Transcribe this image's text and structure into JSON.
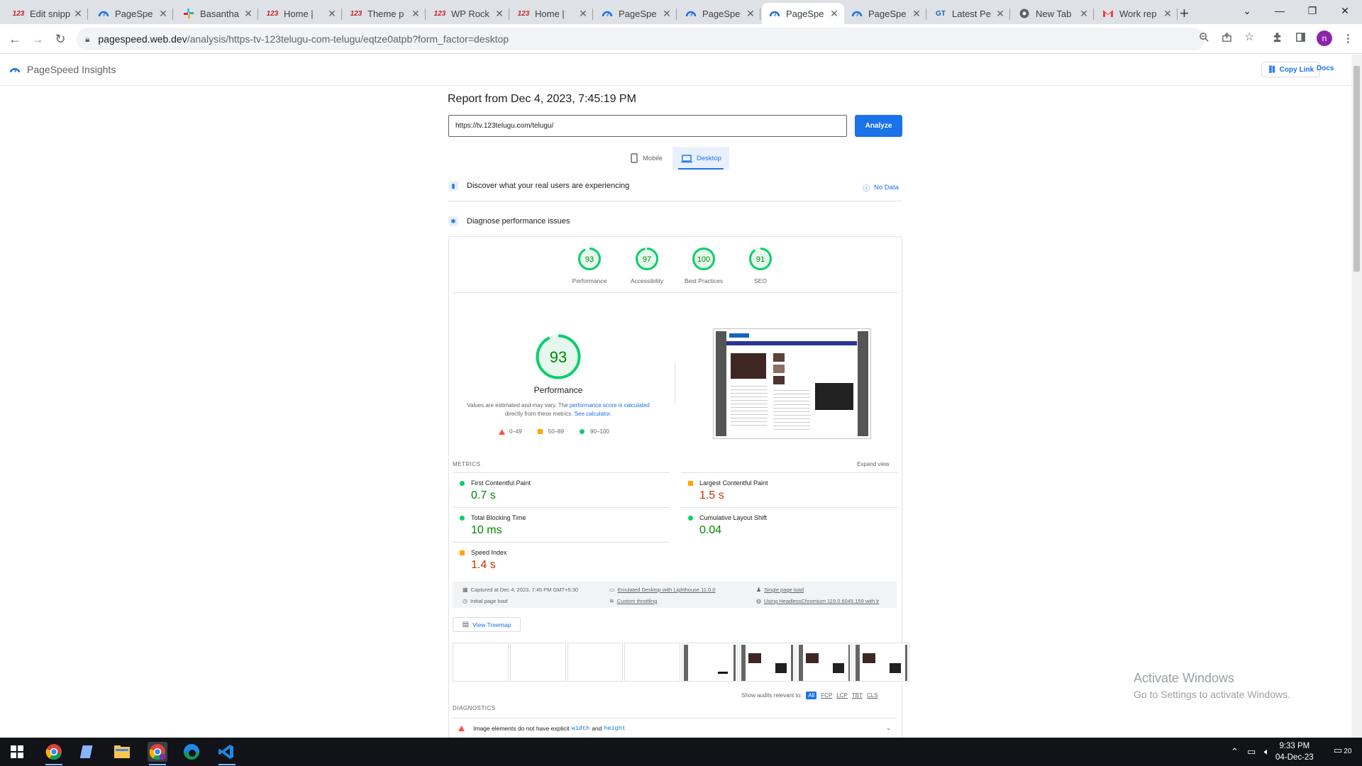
{
  "browser": {
    "tabs": [
      {
        "title": "Edit snipp",
        "icon": "123telugu-icon"
      },
      {
        "title": "PageSpe",
        "icon": "pagespeed-icon"
      },
      {
        "title": "Basantha",
        "icon": "slack-icon"
      },
      {
        "title": "Home |",
        "icon": "123telugu-icon"
      },
      {
        "title": "Theme p",
        "icon": "123telugu-icon"
      },
      {
        "title": "WP Rock",
        "icon": "123telugu-icon"
      },
      {
        "title": "Home |",
        "icon": "123telugu-icon"
      },
      {
        "title": "PageSpe",
        "icon": "pagespeed-icon"
      },
      {
        "title": "PageSpe",
        "icon": "pagespeed-icon"
      },
      {
        "title": "PageSpe",
        "icon": "pagespeed-icon",
        "active": true
      },
      {
        "title": "PageSpe",
        "icon": "pagespeed-icon"
      },
      {
        "title": "Latest Pe",
        "icon": "gt-icon"
      },
      {
        "title": "New Tab",
        "icon": "chrome-icon"
      },
      {
        "title": "Work rep",
        "icon": "gmail-icon"
      }
    ],
    "url_host": "pagespeed.web.dev",
    "url_path": "/analysis/https-tv-123telugu-com-telugu/eqtze0atpb?form_factor=desktop",
    "avatar_letter": "n"
  },
  "psi": {
    "app_title": "PageSpeed Insights",
    "copy_link": "Copy Link",
    "docs": "Docs",
    "report_title": "Report from Dec 4, 2023, 7:45:19 PM",
    "url_value": "https://tv.123telugu.com/telugu/",
    "analyze": "Analyze",
    "form_factors": {
      "mobile": "Mobile",
      "desktop": "Desktop"
    },
    "discover": "Discover what your real users are experiencing",
    "no_data": "No Data",
    "diagnose": "Diagnose performance issues",
    "scores": [
      {
        "label": "Performance",
        "value": 93
      },
      {
        "label": "Accessibility",
        "value": 97
      },
      {
        "label": "Best Practices",
        "value": 100
      },
      {
        "label": "SEO",
        "value": 91
      }
    ],
    "big_score": {
      "value": 93,
      "label": "Performance"
    },
    "note_part1": "Values are estimated and may vary. The ",
    "note_link1": "performance score is calculated",
    "note_part2": " directly from these metrics. ",
    "note_link2": "See calculator.",
    "legend": {
      "low": "0–49",
      "mid": "50–89",
      "high": "90–100"
    },
    "metrics_label": "METRICS",
    "expand_view": "Expand view",
    "metrics": [
      {
        "name": "First Contentful Paint",
        "value": "0.7 s",
        "status": "good"
      },
      {
        "name": "Largest Contentful Paint",
        "value": "1.5 s",
        "status": "average"
      },
      {
        "name": "Total Blocking Time",
        "value": "10 ms",
        "status": "good"
      },
      {
        "name": "Cumulative Layout Shift",
        "value": "0.04",
        "status": "good"
      },
      {
        "name": "Speed Index",
        "value": "1.4 s",
        "status": "average"
      }
    ],
    "info": {
      "captured": "Captured at Dec 4, 2023, 7:45 PM GMT+5:30",
      "initial": "Initial page load",
      "emulated": "Emulated Desktop with Lighthouse 11.0.0",
      "throttling": "Custom throttling",
      "single": "Single page load",
      "chromium": "Using HeadlessChromium 119.0.6045.159 with lr"
    },
    "view_treemap": "View Treemap",
    "show_audits": "Show audits relevant to:",
    "audit_filters": [
      "All",
      "FCP",
      "LCP",
      "TBT",
      "CLS"
    ],
    "diagnostics_label": "DIAGNOSTICS",
    "diag_item_text": "Image elements do not have explicit",
    "diag_code1": "width",
    "diag_and": "and",
    "diag_code2": "height"
  },
  "os": {
    "watermark_title": "Activate Windows",
    "watermark_sub": "Go to Settings to activate Windows.",
    "time": "9:33 PM",
    "date": "04-Dec-23",
    "notif_count": "20"
  },
  "colors": {
    "good": "#0cce6b",
    "average": "#ffa400",
    "poor": "#ff4e42",
    "accent": "#1a73e8"
  }
}
